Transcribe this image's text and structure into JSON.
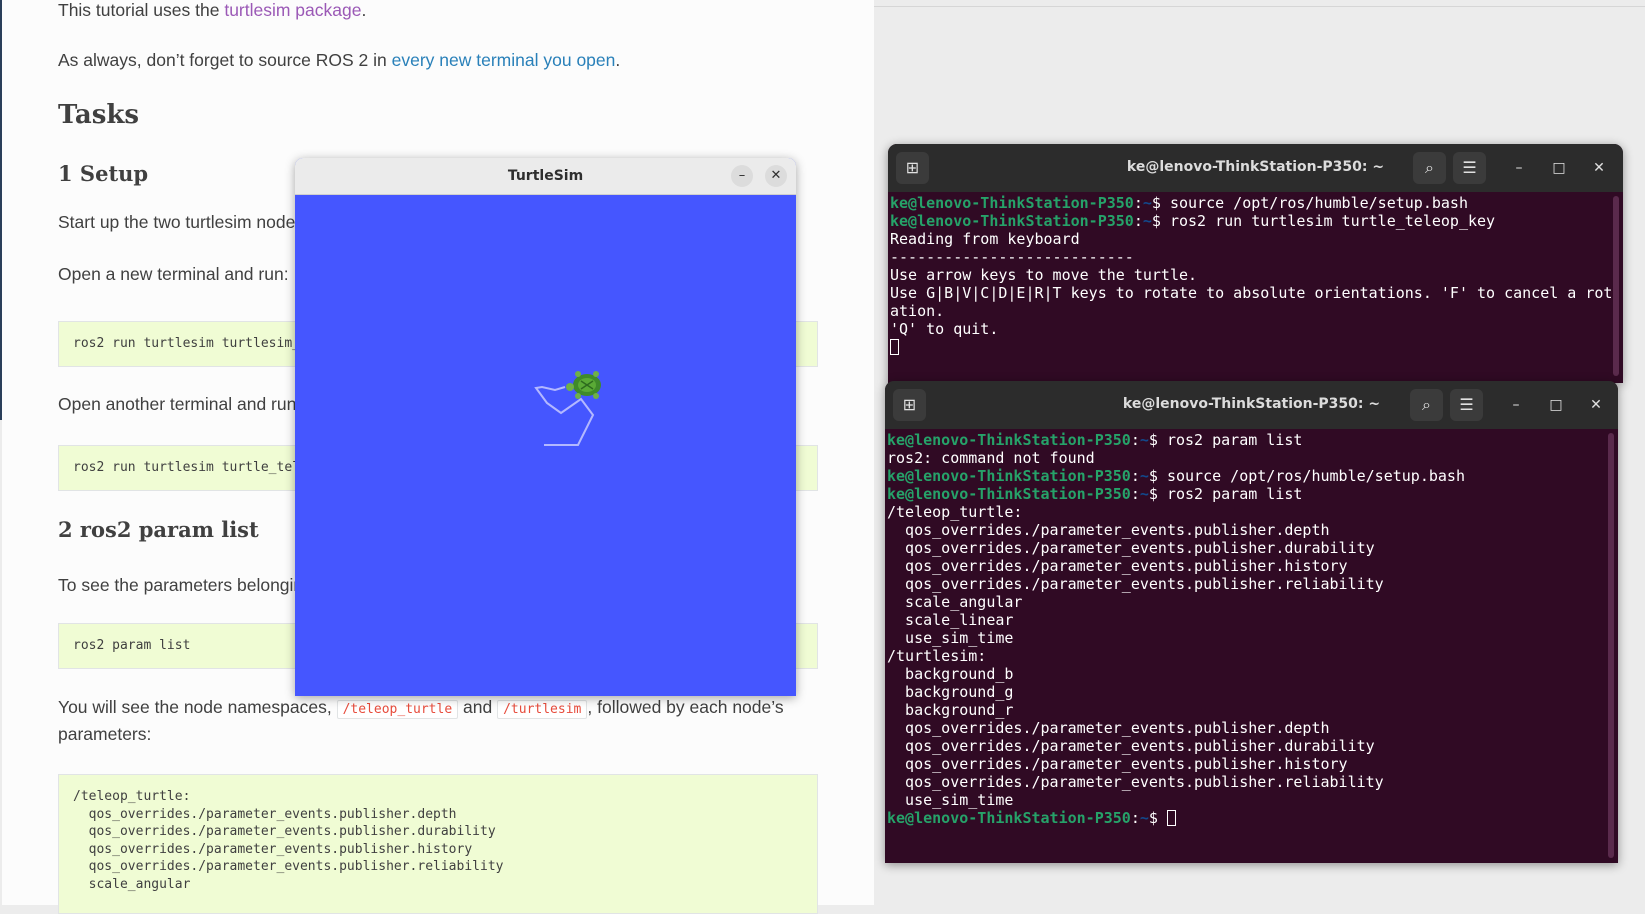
{
  "doc": {
    "intro_prefix": "This tutorial uses the ",
    "intro_link": "turtlesim package",
    "intro_suffix": ".",
    "source_prefix": "As always, don’t forget to source ROS 2 in ",
    "source_link": "every new terminal you open",
    "source_suffix": ".",
    "tasks_heading": "Tasks",
    "setup_heading": "1 Setup",
    "setup_text": "Start up the two turtlesim node",
    "open_terminal_text": "Open a new terminal and run:",
    "code_turtlesim_node": "ros2 run turtlesim turtlesim_",
    "open_another_text": "Open another terminal and run",
    "code_teleop": "ros2 run turtlesim turtle_tel",
    "param_list_heading": "2 ros2 param list",
    "param_list_text": "To see the parameters belongin",
    "code_param_list": "ros2 param list",
    "namespaces_prefix": "You will see the node namespaces, ",
    "namespace_teleop": "/teleop_turtle",
    "namespaces_and": " and ",
    "namespace_turtlesim": "/turtlesim",
    "namespaces_suffix": ", followed by each node’s",
    "namespaces_line2": "parameters:",
    "output_code": [
      "/teleop_turtle:",
      "  qos_overrides./parameter_events.publisher.depth",
      "  qos_overrides./parameter_events.publisher.durability",
      "  qos_overrides./parameter_events.publisher.history",
      "  qos_overrides./parameter_events.publisher.reliability",
      "  scale_angular"
    ]
  },
  "turtlesim_window": {
    "title": "TurtleSim",
    "minimize_label": "–",
    "close_label": "✕",
    "background_color": "#4556ff",
    "turtle_icon": "turtle-icon"
  },
  "terminal1": {
    "title": "ke@lenovo-ThinkStation-P350: ~",
    "new_tab_icon": "new-tab-icon",
    "search_icon": "search-icon",
    "menu_icon": "hamburger-menu-icon",
    "lines": [
      {
        "user": "ke@lenovo-ThinkStation-P350",
        "path": "~",
        "cmd": "$ source /opt/ros/humble/setup.bash"
      },
      {
        "user": "ke@lenovo-ThinkStation-P350",
        "path": "~",
        "cmd": "$ ros2 run turtlesim turtle_teleop_key"
      },
      {
        "text": "Reading from keyboard"
      },
      {
        "text": "---------------------------"
      },
      {
        "text": "Use arrow keys to move the turtle."
      },
      {
        "text": "Use G|B|V|C|D|E|R|T keys to rotate to absolute orientations. 'F' to cancel a rot"
      },
      {
        "text": "ation."
      },
      {
        "text": "'Q' to quit."
      }
    ]
  },
  "terminal2": {
    "title": "ke@lenovo-ThinkStation-P350: ~",
    "lines": [
      {
        "user": "ke@lenovo-ThinkStation-P350",
        "path": "~",
        "cmd": "$ ros2 param list"
      },
      {
        "text": "ros2: command not found"
      },
      {
        "user": "ke@lenovo-ThinkStation-P350",
        "path": "~",
        "cmd": "$ source /opt/ros/humble/setup.bash"
      },
      {
        "user": "ke@lenovo-ThinkStation-P350",
        "path": "~",
        "cmd": "$ ros2 param list"
      },
      {
        "text": "/teleop_turtle:"
      },
      {
        "text": "  qos_overrides./parameter_events.publisher.depth"
      },
      {
        "text": "  qos_overrides./parameter_events.publisher.durability"
      },
      {
        "text": "  qos_overrides./parameter_events.publisher.history"
      },
      {
        "text": "  qos_overrides./parameter_events.publisher.reliability"
      },
      {
        "text": "  scale_angular"
      },
      {
        "text": "  scale_linear"
      },
      {
        "text": "  use_sim_time"
      },
      {
        "text": "/turtlesim:"
      },
      {
        "text": "  background_b"
      },
      {
        "text": "  background_g"
      },
      {
        "text": "  background_r"
      },
      {
        "text": "  qos_overrides./parameter_events.publisher.depth"
      },
      {
        "text": "  qos_overrides./parameter_events.publisher.durability"
      },
      {
        "text": "  qos_overrides./parameter_events.publisher.history"
      },
      {
        "text": "  qos_overrides./parameter_events.publisher.reliability"
      },
      {
        "text": "  use_sim_time"
      },
      {
        "user": "ke@lenovo-ThinkStation-P350",
        "path": "~",
        "cmd": "$ ",
        "cursor": true
      }
    ]
  }
}
